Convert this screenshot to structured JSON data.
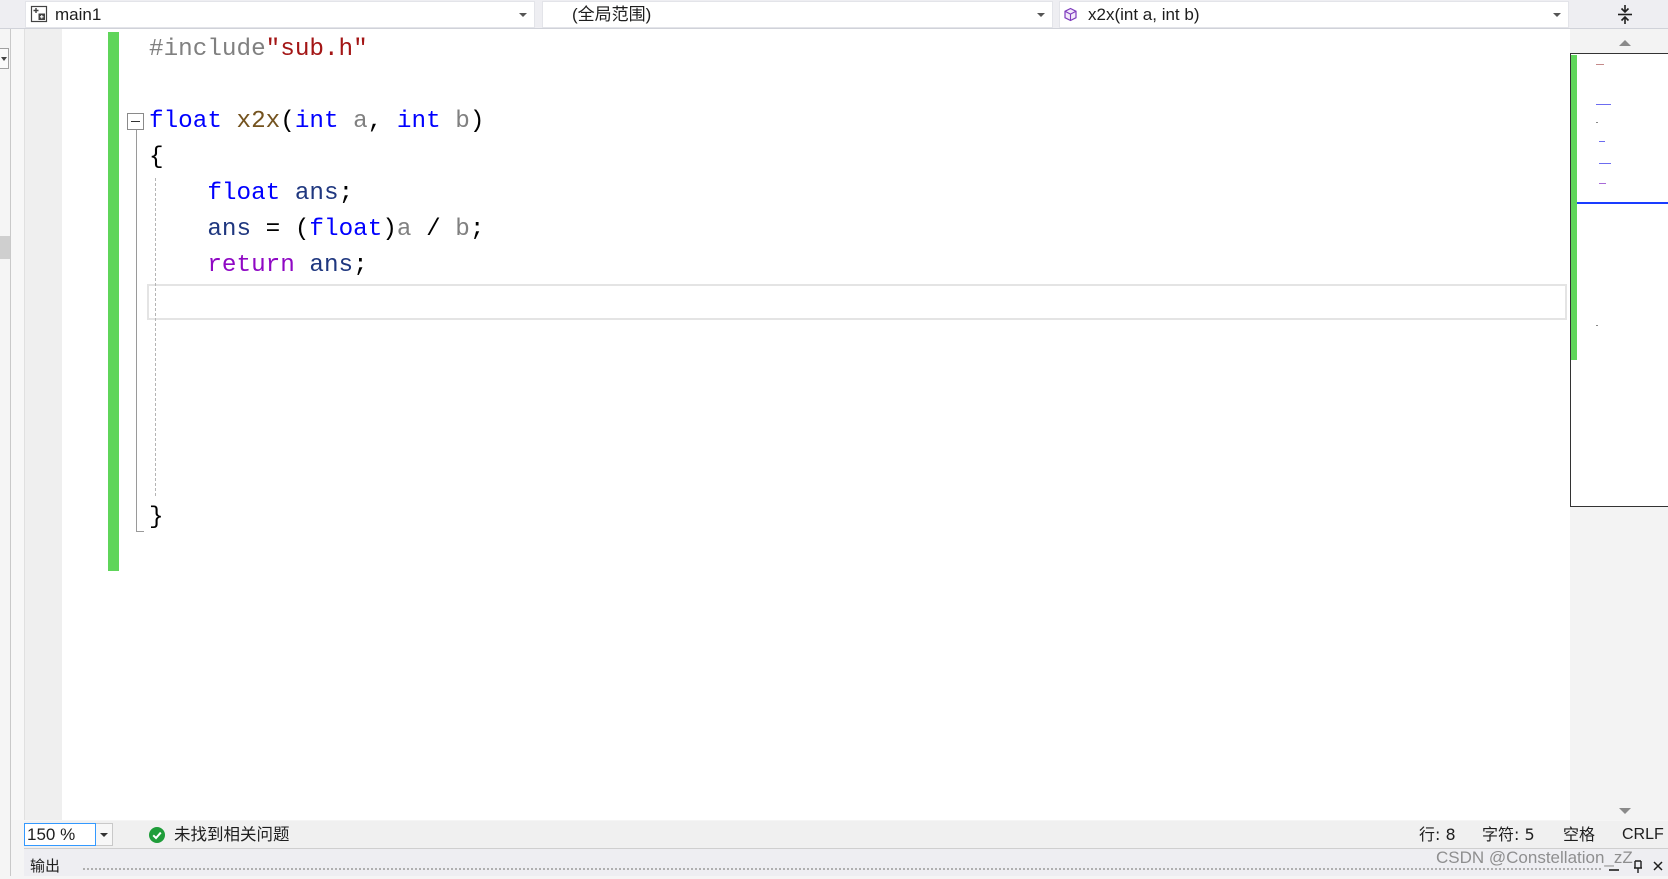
{
  "navigation_bar": {
    "project_dropdown": {
      "label": "main1",
      "icon": "project-icon"
    },
    "scope_dropdown": {
      "label": "(全局范围)"
    },
    "member_dropdown": {
      "label": "x2x(int a, int b)",
      "icon": "method-icon"
    },
    "split_button": {
      "icon": "split-window-icon"
    }
  },
  "editor": {
    "change_bar_color": "#5fd55a",
    "lines": [
      {
        "tokens": [
          {
            "text": "#include",
            "color": "#808080"
          },
          {
            "text": "\"sub.h\"",
            "color": "#a31515"
          }
        ]
      },
      {
        "tokens": []
      },
      {
        "tokens": [
          {
            "text": "float",
            "color": "#0000ff"
          },
          {
            "text": " x2x",
            "color": "#74531f"
          },
          {
            "text": "(",
            "color": "#000000"
          },
          {
            "text": "int",
            "color": "#0000ff"
          },
          {
            "text": " a",
            "color": "#808080"
          },
          {
            "text": ",",
            "color": "#000000"
          },
          {
            "text": " int",
            "color": "#0000ff"
          },
          {
            "text": " b",
            "color": "#808080"
          },
          {
            "text": ")",
            "color": "#000000"
          }
        ]
      },
      {
        "tokens": [
          {
            "text": "{",
            "color": "#000000"
          }
        ]
      },
      {
        "tokens": [
          {
            "text": "    float",
            "color": "#0000ff"
          },
          {
            "text": " ans",
            "color": "#1f377f"
          },
          {
            "text": ";",
            "color": "#000000"
          }
        ]
      },
      {
        "tokens": [
          {
            "text": "    ans",
            "color": "#1f377f"
          },
          {
            "text": " = (",
            "color": "#000000"
          },
          {
            "text": "float",
            "color": "#0000ff"
          },
          {
            "text": ")",
            "color": "#000000"
          },
          {
            "text": "a",
            "color": "#808080"
          },
          {
            "text": " / ",
            "color": "#000000"
          },
          {
            "text": "b",
            "color": "#808080"
          },
          {
            "text": ";",
            "color": "#000000"
          }
        ]
      },
      {
        "tokens": [
          {
            "text": "    return",
            "color": "#8f08c4"
          },
          {
            "text": " ans",
            "color": "#1f377f"
          },
          {
            "text": ";",
            "color": "#000000"
          }
        ]
      },
      {
        "tokens": []
      },
      {
        "tokens": []
      },
      {
        "tokens": []
      },
      {
        "tokens": []
      },
      {
        "tokens": []
      },
      {
        "tokens": []
      },
      {
        "tokens": [
          {
            "text": "}",
            "color": "#000000"
          }
        ]
      }
    ]
  },
  "scrollbar": {
    "up_icon": "scroll-up-arrow-icon",
    "down_icon": "scroll-down-arrow-icon",
    "viewport_line_color": "#1a3cff"
  },
  "status_bar": {
    "zoom": "150 %",
    "issues": {
      "icon": "check-circle-icon",
      "text": "未找到相关问题",
      "color": "#1f9d3a"
    },
    "line": "行: 8",
    "column": "字符: 5",
    "indentation": "空格",
    "line_ending": "CRLF"
  },
  "output_panel": {
    "title": "输出",
    "icons": [
      "minimize-icon",
      "pin-icon",
      "close-icon"
    ]
  },
  "watermark": "CSDN @Constellation_zZ"
}
